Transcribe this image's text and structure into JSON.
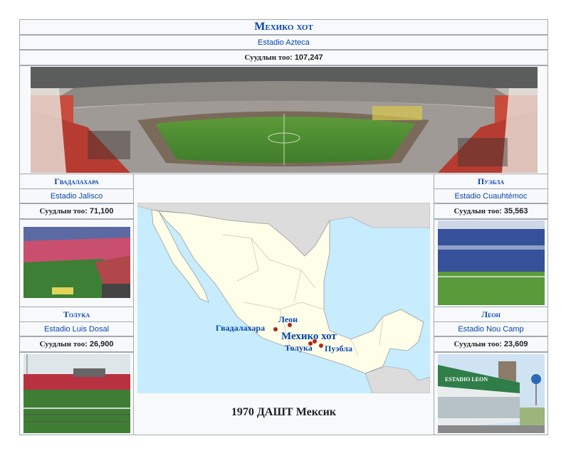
{
  "main": {
    "city": "Мехико хот",
    "stadium": "Estadio Azteca",
    "capacity_label": "Суудлын тоо",
    "capacity_value": "107,247"
  },
  "left": [
    {
      "city": "Гвадалахара",
      "stadium": "Estadio Jalisco",
      "capacity_label": "Суудлын тоо",
      "capacity_value": "71,100"
    },
    {
      "city": "Толука",
      "stadium": "Estadio Luis Dosal",
      "capacity_label": "Суудлын тоо",
      "capacity_value": "26,900"
    }
  ],
  "right": [
    {
      "city": "Пуэбла",
      "stadium": "Estadio Cuauhtémoc",
      "capacity_label": "Суудлын тоо",
      "capacity_value": "35,563"
    },
    {
      "city": "Леон",
      "stadium": "Estadio Nou Camp",
      "capacity_label": "Суудлын тоо",
      "capacity_value": "23,609"
    }
  ],
  "map": {
    "caption": "1970 ДАШТ Мексик",
    "labels": {
      "leon": "Леон",
      "guadalajara": "Гвадалахара",
      "mexico": "Мехико хот",
      "toluca": "Толука",
      "puebla": "Пуэбла"
    },
    "sign_text": "ESTADIO LEON"
  },
  "colors": {
    "link": "#0645ad",
    "border": "#a2a9b1",
    "cell_bg": "#f8f9fa",
    "sea": "#c6ecfe",
    "land": "#fefee9",
    "marker": "#b0261a"
  }
}
